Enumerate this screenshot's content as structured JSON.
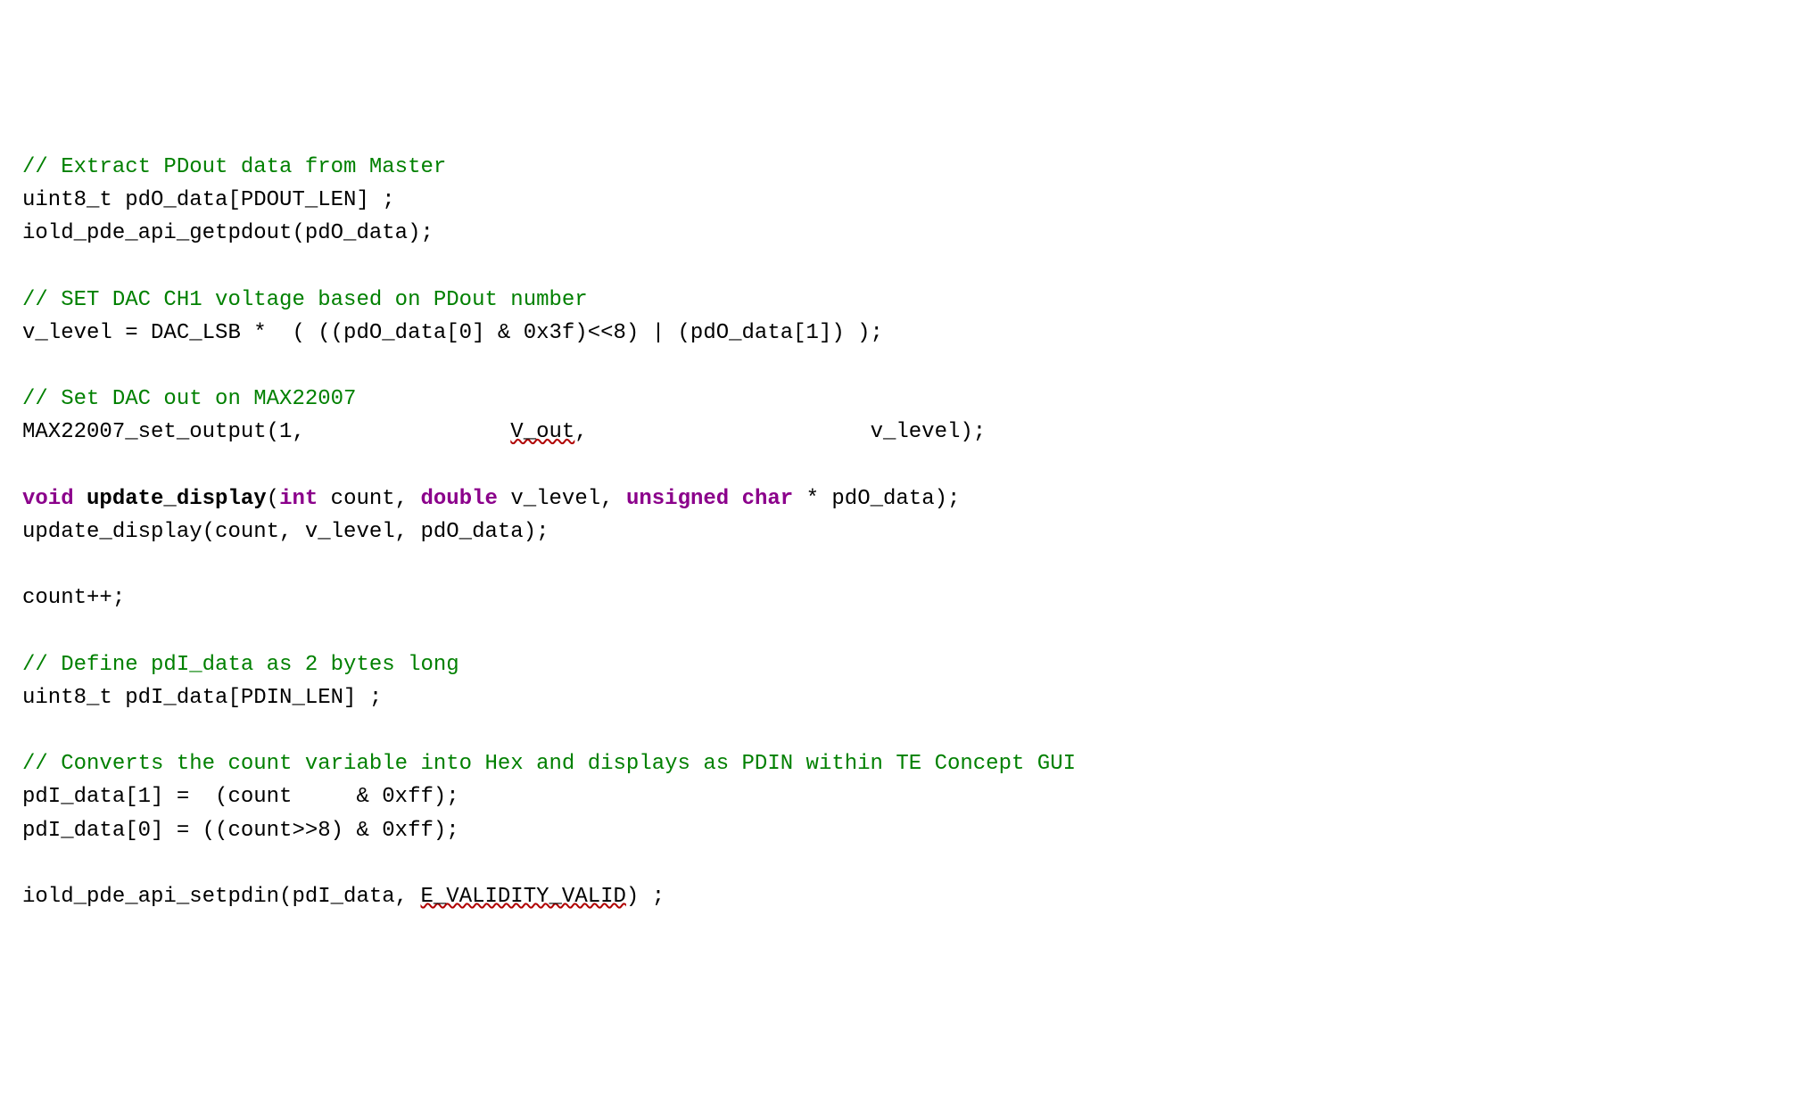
{
  "code": {
    "c1": "// Extract PDout data from Master",
    "l2": "uint8_t pdO_data[PDOUT_LEN] ;",
    "l3": "iold_pde_api_getpdout(pdO_data);",
    "c4": "// SET DAC CH1 voltage based on PDout number",
    "l5": "v_level = DAC_LSB *  ( ((pdO_data[0] & 0x3f)<<8) | (pdO_data[1]) );",
    "c6": "// Set DAC out on MAX22007",
    "l7a": "MAX22007_set_output(1,                ",
    "l7b": "V_out",
    "l7c": ",                      v_level);",
    "l8_kw_void": "void",
    "l8_sp1": " ",
    "l8_fn": "update_display",
    "l8_paren": "(",
    "l8_kw_int": "int",
    "l8_p1": " count, ",
    "l8_kw_double": "double",
    "l8_p2": " v_level, ",
    "l8_kw_unsigned": "unsigned",
    "l8_sp2": " ",
    "l8_kw_char": "char",
    "l8_p3": " * pdO_data);",
    "l9": "update_display(count, v_level, pdO_data);",
    "l10": "count++;",
    "c11": "// Define pdI_data as 2 bytes long",
    "l12": "uint8_t pdI_data[PDIN_LEN] ;",
    "c13": "// Converts the count variable into Hex and displays as PDIN within TE Concept GUI",
    "l14": "pdI_data[1] =  (count     & 0xff);",
    "l15": "pdI_data[0] = ((count>>8) & 0xff);",
    "l16a": "iold_pde_api_setpdin(pdI_data, ",
    "l16b": "E_VALIDITY_VALID",
    "l16c": ") ;"
  }
}
